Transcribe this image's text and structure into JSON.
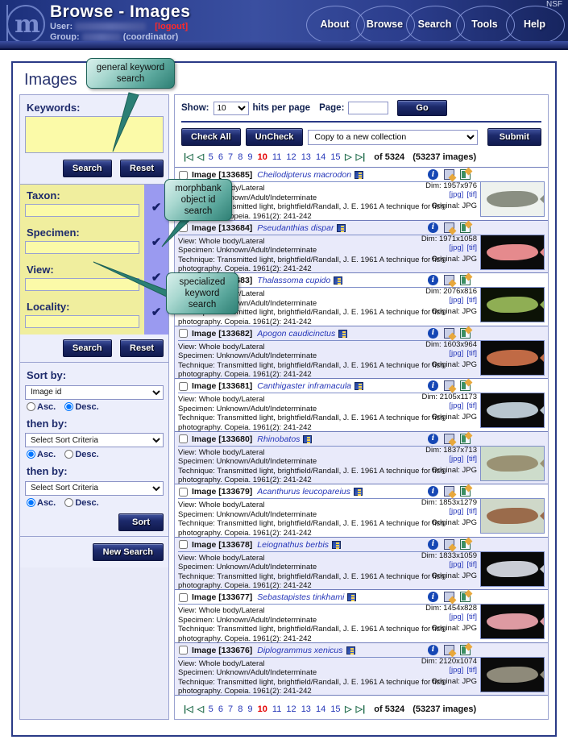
{
  "header": {
    "title": "Browse - Images",
    "user_label": "User:",
    "user_name": "Debbie Paul",
    "logout": "[logout]",
    "group_label": "Group:",
    "group_name": "Plants",
    "group_role": "(coordinator)",
    "nsf": "NSF",
    "nav": [
      {
        "label": "About"
      },
      {
        "label": "Browse"
      },
      {
        "label": "Search"
      },
      {
        "label": "Tools"
      },
      {
        "label": "Help"
      }
    ]
  },
  "page": {
    "title": "Images"
  },
  "sidebar": {
    "keywords_label": "Keywords:",
    "keywords_value": "",
    "search_label": "Search",
    "reset_label": "Reset",
    "fields": [
      {
        "label": "Taxon:",
        "value": "",
        "checked": true
      },
      {
        "label": "Specimen:",
        "value": "",
        "checked": true
      },
      {
        "label": "View:",
        "value": "",
        "checked": true
      },
      {
        "label": "Locality:",
        "value": "",
        "checked": true
      }
    ],
    "search2_label": "Search",
    "reset2_label": "Reset",
    "sort": {
      "sort_by_label": "Sort by:",
      "then_by_label": "then by:",
      "asc_label": "Asc.",
      "desc_label": "Desc.",
      "criteria": [
        {
          "value": "Image id",
          "order": "Desc."
        },
        {
          "value": "Select Sort Criteria",
          "order": "Asc."
        },
        {
          "value": "Select Sort Criteria",
          "order": "Asc."
        }
      ],
      "sort_button": "Sort"
    },
    "new_search_label": "New Search"
  },
  "toolbar": {
    "show_label": "Show:",
    "show_value": "10",
    "hits_label": "hits per page",
    "page_label": "Page:",
    "page_value": "",
    "go_label": "Go",
    "check_all_label": "Check All",
    "uncheck_label": "UnCheck",
    "collection_select": "Copy to a new collection",
    "submit_label": "Submit"
  },
  "pager": {
    "first": "|◁",
    "prev": "◁",
    "pages": [
      "5",
      "6",
      "7",
      "8",
      "9",
      "10",
      "11",
      "12",
      "13",
      "14",
      "15"
    ],
    "current": "10",
    "next": "▷",
    "last": "▷|",
    "of_label": "of 5324",
    "total_label": "(53237 images)"
  },
  "labels": {
    "image_prefix": "Image",
    "view": "View: Whole body/Lateral",
    "specimen": "Specimen: Unknown/Adult/Indeterminate",
    "technique_1": "Technique: Transmitted light, brightfield/Randall, J. E. 1961 A technique for fish",
    "technique_2": "photography. Copeia. 1961(2): 241-242",
    "dim_prefix": "Dim:",
    "jpg": "[jpg]",
    "tif": "[tif]",
    "original": "Original: JPG"
  },
  "rows": [
    {
      "id": "[133685]",
      "name": "Cheilodipterus macrodon",
      "dim": "1957x976",
      "body": "#8a8f82",
      "bg": "#eef2ee"
    },
    {
      "id": "[133684]",
      "name": "Pseudanthias dispar",
      "dim": "1971x1058",
      "body": "#e58a8d",
      "bg": "#0b0b0b"
    },
    {
      "id": "[133683]",
      "name": "Thalassoma cupido",
      "dim": "2076x816",
      "body": "#8fae54",
      "bg": "#0c1206"
    },
    {
      "id": "[133682]",
      "name": "Apogon caudicinctus",
      "dim": "1603x964",
      "body": "#c06a45",
      "bg": "#090909"
    },
    {
      "id": "[133681]",
      "name": "Canthigaster inframacula",
      "dim": "2105x1173",
      "body": "#b9c6cf",
      "bg": "#0a0a0a"
    },
    {
      "id": "[133680]",
      "name": "Rhinobatos",
      "dim": "1837x713",
      "body": "#9a9274",
      "bg": "#cddccb"
    },
    {
      "id": "[133679]",
      "name": "Acanthurus leucopareius",
      "dim": "1853x1279",
      "body": "#9a6b4b",
      "bg": "#cfd8c9"
    },
    {
      "id": "[133678]",
      "name": "Leiognathus berbis",
      "dim": "1833x1059",
      "body": "#c9ccd4",
      "bg": "#090909"
    },
    {
      "id": "[133677]",
      "name": "Sebastapistes tinkhami",
      "dim": "1454x828",
      "body": "#dd9aa2",
      "bg": "#0a0a0a"
    },
    {
      "id": "[133676]",
      "name": "Diplogrammus xenicus",
      "dim": "2120x1074",
      "body": "#8e8a7a",
      "bg": "#0b0b0b"
    }
  ],
  "callouts": [
    {
      "id": "general",
      "text": "general keyword\nsearch"
    },
    {
      "id": "morphbank",
      "text": "morphbank\nobject id\nsearch"
    },
    {
      "id": "specialized",
      "text": "specialized\nkeyword\nsearch"
    }
  ]
}
